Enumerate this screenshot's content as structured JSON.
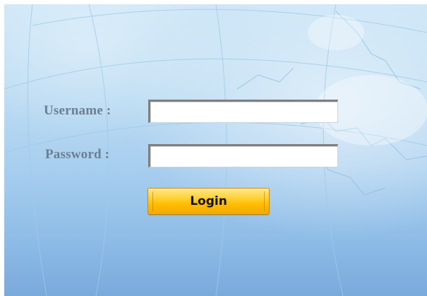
{
  "login_form": {
    "username_label": "Username :",
    "password_label": "Password :",
    "username_value": "",
    "password_value": "",
    "login_label": "Login"
  },
  "colors": {
    "background_top": "#cde6f7",
    "background_bottom": "#7aa9dc",
    "label_text": "#6b7f92",
    "button_fill": "#ffbf00"
  },
  "icons": [
    "globe-background"
  ]
}
